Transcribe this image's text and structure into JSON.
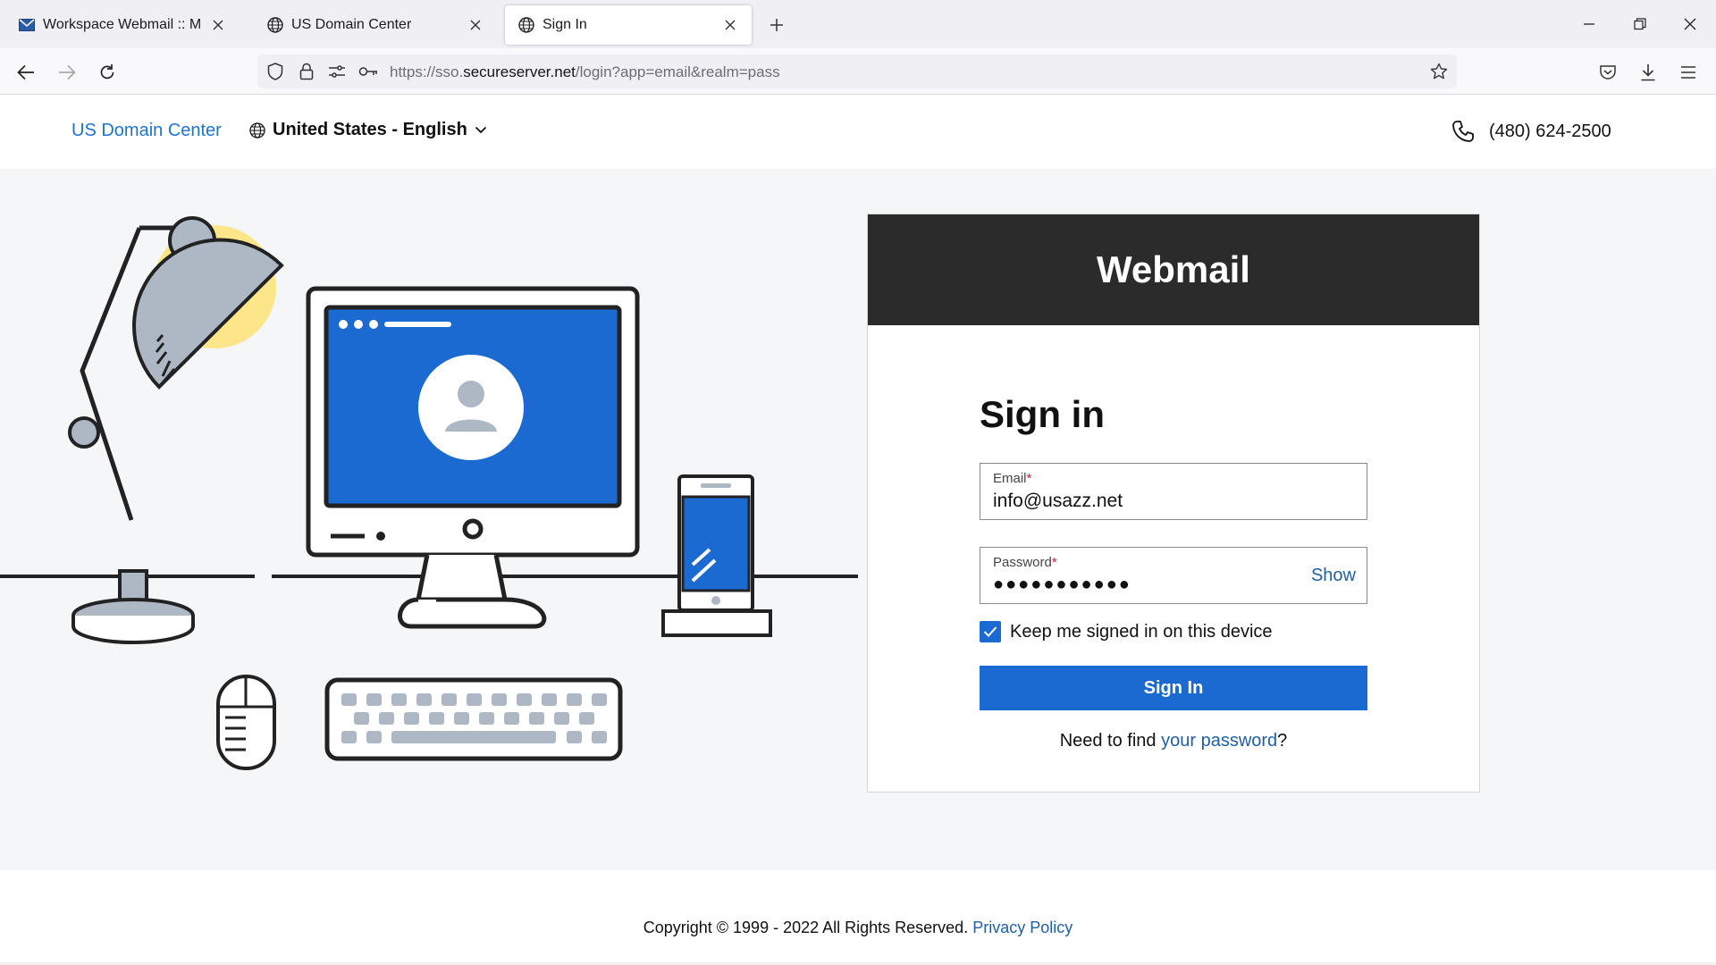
{
  "browser": {
    "tabs": [
      {
        "label": "Workspace Webmail :: Mail Index",
        "icon": "mail-icon",
        "active": false
      },
      {
        "label": "US Domain Center",
        "icon": "globe-icon",
        "active": false
      },
      {
        "label": "Sign In",
        "icon": "globe-icon",
        "active": true
      }
    ],
    "url": {
      "prefix": "https://sso.",
      "domain": "secureserver.net",
      "path": "/login?app=email&realm=pass"
    }
  },
  "header": {
    "brand": "US Domain Center",
    "language": "United States - English",
    "phone": "(480) 624-2500"
  },
  "card": {
    "title": "Webmail",
    "heading": "Sign in",
    "email": {
      "label": "Email",
      "required_mark": "*",
      "value": "info@usazz.net"
    },
    "password": {
      "label": "Password",
      "required_mark": "*",
      "masked_value": "●●●●●●●●●●●",
      "show_label": "Show"
    },
    "keep_signed_in": {
      "label": "Keep me signed in on this device",
      "checked": true
    },
    "submit_label": "Sign In",
    "help": {
      "prefix": "Need to find ",
      "link": "your password",
      "suffix": "?"
    }
  },
  "footer": {
    "copyright": "Copyright © 1999 - 2022 All Rights Reserved.",
    "privacy_link": "Privacy Policy"
  },
  "colors": {
    "primary_blue": "#1b6ad1",
    "link_blue": "#1f73d0",
    "annotation_orange": "#f28a2e",
    "card_header": "#2b2b2b"
  }
}
